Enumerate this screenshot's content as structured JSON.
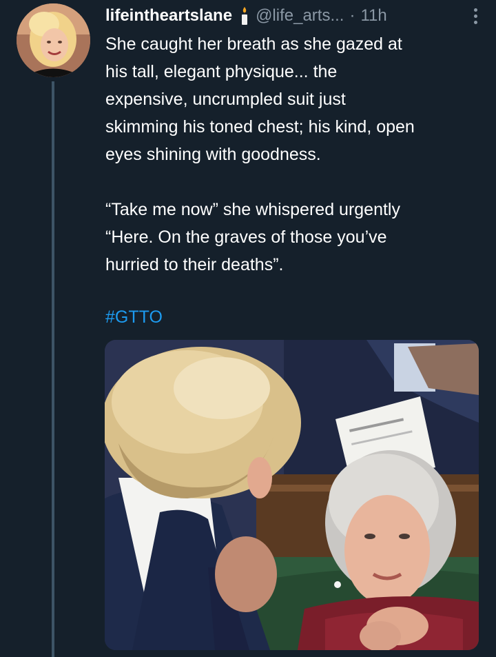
{
  "tweet": {
    "display_name": "lifeintheartslane",
    "handle": "@life_arts...",
    "separator": "·",
    "time": "11h",
    "text_lines_p1": [
      "She caught her breath as she gazed at",
      "his tall, elegant physique... the",
      "expensive, uncrumpled suit just",
      "skimming his toned chest; his kind, open",
      "eyes shining with goodness."
    ],
    "text_lines_p2": [
      "“Take me now” she whispered urgently",
      "“Here. On the graves of those you’ve",
      "hurried to their deaths”."
    ],
    "hashtag": "#GTTO"
  },
  "icons": {
    "badge": "candle-icon",
    "menu": "more-vertical-icon"
  },
  "colors": {
    "background": "#15202b",
    "text": "#ffffff",
    "secondary_text": "#8b98a5",
    "link": "#1d9bf0",
    "thread_line": "#3d5466"
  }
}
